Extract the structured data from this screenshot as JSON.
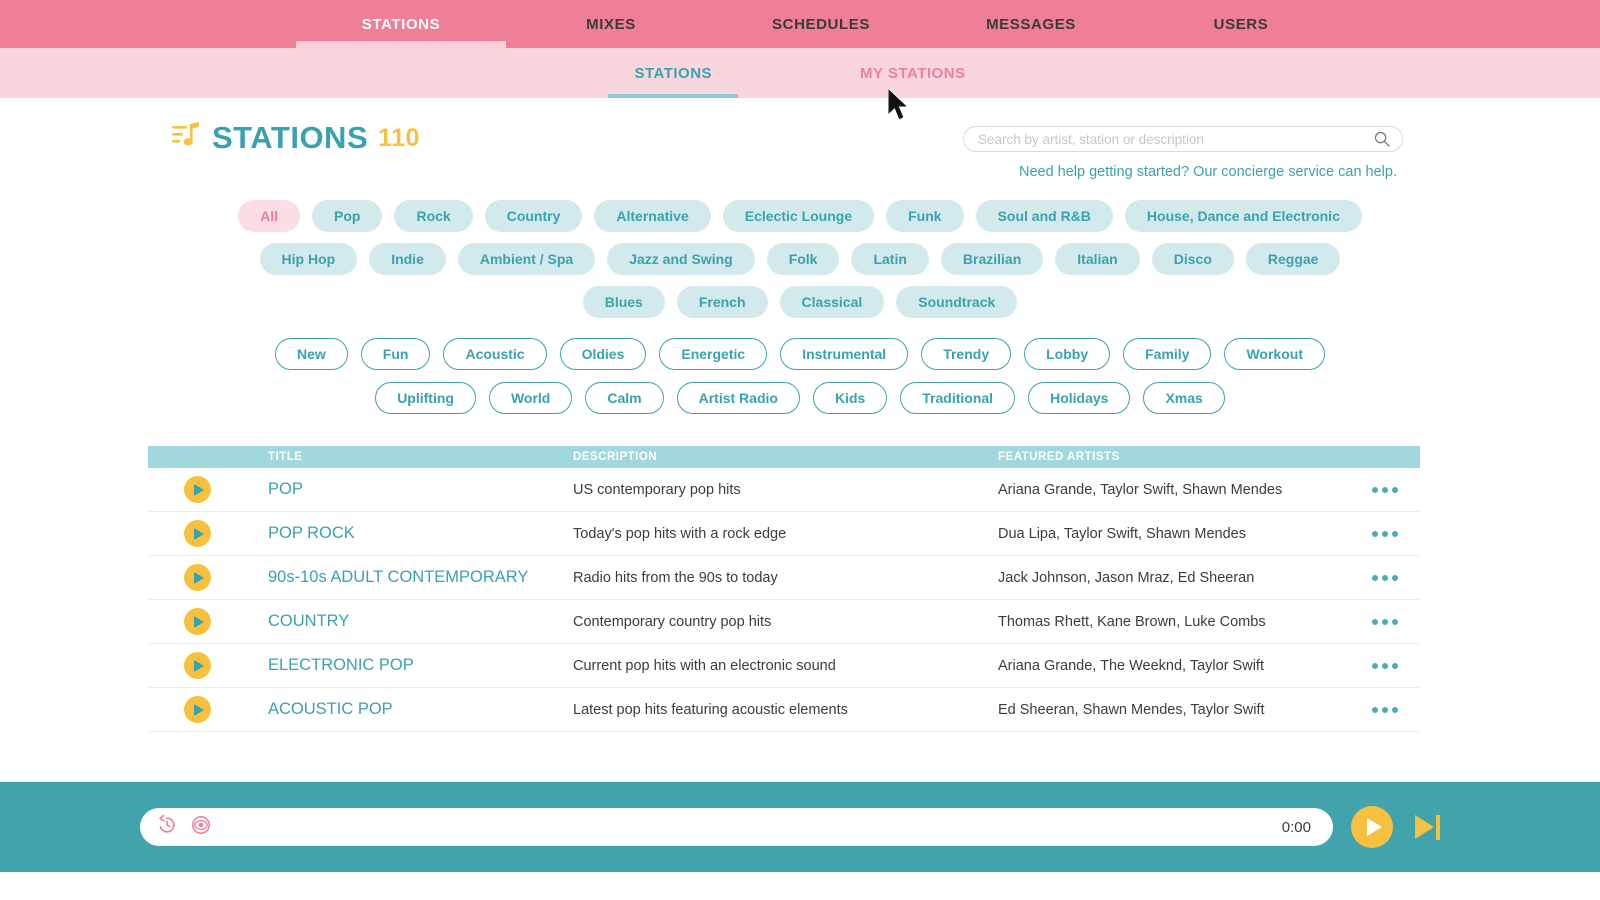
{
  "colors": {
    "pink": "#ef7f96",
    "light_pink": "#f9d6dd",
    "teal": "#3ba2ad",
    "player_teal": "#41a3ac",
    "yellow": "#f7c13f",
    "chip_bg": "#d3eaec",
    "table_header": "#a1d8de"
  },
  "topnav": {
    "items": [
      {
        "label": "STATIONS",
        "active": true
      },
      {
        "label": "MIXES",
        "active": false
      },
      {
        "label": "SCHEDULES",
        "active": false
      },
      {
        "label": "MESSAGES",
        "active": false
      },
      {
        "label": "USERS",
        "active": false
      }
    ]
  },
  "subnav": {
    "stations_label": "STATIONS",
    "my_stations_label": "MY STATIONS"
  },
  "header": {
    "brand_icon": "playlist-music-icon",
    "title": "STATIONS",
    "count": "110"
  },
  "search": {
    "placeholder": "Search by artist, station or description",
    "value": "",
    "icon": "search-icon",
    "concierge_text": "Need help getting started? Our concierge service can help."
  },
  "genre_rows": [
    [
      {
        "label": "All",
        "selected": true
      },
      {
        "label": "Pop",
        "selected": false
      },
      {
        "label": "Rock",
        "selected": false
      },
      {
        "label": "Country",
        "selected": false
      },
      {
        "label": "Alternative",
        "selected": false
      },
      {
        "label": "Eclectic Lounge",
        "selected": false
      },
      {
        "label": "Funk",
        "selected": false
      },
      {
        "label": "Soul and R&B",
        "selected": false
      },
      {
        "label": "House, Dance and Electronic",
        "selected": false
      }
    ],
    [
      {
        "label": "Hip Hop",
        "selected": false
      },
      {
        "label": "Indie",
        "selected": false
      },
      {
        "label": "Ambient / Spa",
        "selected": false
      },
      {
        "label": "Jazz and Swing",
        "selected": false
      },
      {
        "label": "Folk",
        "selected": false
      },
      {
        "label": "Latin",
        "selected": false
      },
      {
        "label": "Brazilian",
        "selected": false
      },
      {
        "label": "Italian",
        "selected": false
      },
      {
        "label": "Disco",
        "selected": false
      },
      {
        "label": "Reggae",
        "selected": false
      }
    ],
    [
      {
        "label": "Blues",
        "selected": false
      },
      {
        "label": "French",
        "selected": false
      },
      {
        "label": "Classical",
        "selected": false
      },
      {
        "label": "Soundtrack",
        "selected": false
      }
    ]
  ],
  "mood_rows": [
    [
      {
        "label": "New"
      },
      {
        "label": "Fun"
      },
      {
        "label": "Acoustic"
      },
      {
        "label": "Oldies"
      },
      {
        "label": "Energetic"
      },
      {
        "label": "Instrumental"
      },
      {
        "label": "Trendy"
      },
      {
        "label": "Lobby"
      },
      {
        "label": "Family"
      },
      {
        "label": "Workout"
      }
    ],
    [
      {
        "label": "Uplifting"
      },
      {
        "label": "World"
      },
      {
        "label": "Calm"
      },
      {
        "label": "Artist Radio"
      },
      {
        "label": "Kids"
      },
      {
        "label": "Traditional"
      },
      {
        "label": "Holidays"
      },
      {
        "label": "Xmas"
      }
    ]
  ],
  "table": {
    "columns": {
      "play": "",
      "title": "TITLE",
      "description": "DESCRIPTION",
      "artists": "FEATURED ARTISTS",
      "menu": ""
    },
    "rows": [
      {
        "title": "POP",
        "description": "US contemporary pop hits",
        "artists": "Ariana Grande, Taylor Swift, Shawn Mendes"
      },
      {
        "title": "POP ROCK",
        "description": "Today's pop hits with a rock edge",
        "artists": "Dua Lipa, Taylor Swift, Shawn Mendes"
      },
      {
        "title": "90s-10s ADULT CONTEMPORARY",
        "description": "Radio hits from the 90s to today",
        "artists": "Jack Johnson, Jason Mraz, Ed Sheeran"
      },
      {
        "title": "COUNTRY",
        "description": "Contemporary country pop hits",
        "artists": "Thomas Rhett, Kane Brown, Luke Combs"
      },
      {
        "title": "ELECTRONIC POP",
        "description": "Current pop hits with an electronic sound",
        "artists": "Ariana Grande, The Weeknd, Taylor Swift"
      },
      {
        "title": "ACOUSTIC POP",
        "description": "Latest pop hits featuring acoustic elements",
        "artists": "Ed Sheeran, Shawn Mendes, Taylor Swift"
      }
    ]
  },
  "player": {
    "history_icon": "history-rewind-icon",
    "preview_icon": "eye-icon",
    "time": "0:00",
    "play_icon": "play-icon",
    "skip_icon": "skip-next-icon"
  },
  "cursor": {
    "icon": "mouse-pointer-icon"
  }
}
